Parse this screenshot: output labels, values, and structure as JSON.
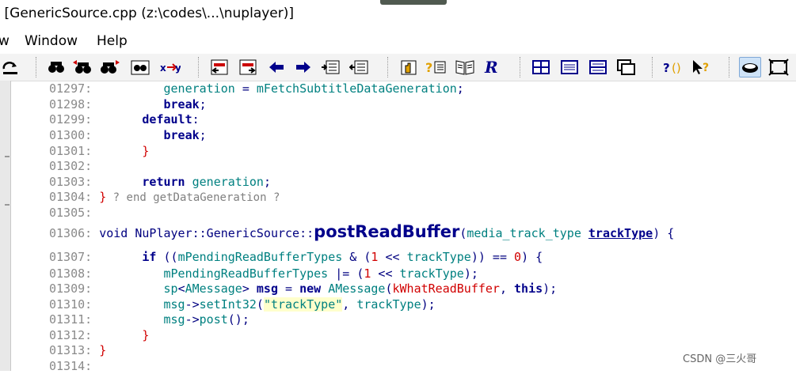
{
  "window": {
    "title": "- [GenericSource.cpp (z:\\codes\\...\\nuplayer)]"
  },
  "menu": {
    "items": [
      "w",
      "Window",
      "Help"
    ]
  },
  "toolbar": {
    "icons": [
      "redo-icon",
      "find-icon",
      "find-prev-icon",
      "find-next-icon",
      "find-files-icon",
      "replace-icon",
      "jump-back-icon",
      "jump-forward-icon",
      "back-arrow-icon",
      "forward-arrow-icon",
      "indent-icon",
      "outdent-icon",
      "symbol-info-icon",
      "relation-icon",
      "book-icon",
      "r-icon",
      "layout-window-icon",
      "layout-panel-icon",
      "layout-split-icon",
      "layout-stack-icon",
      "context-help-icon",
      "pointer-help-icon",
      "toggle-icon",
      "frame-icon"
    ]
  },
  "code": {
    "lines": [
      {
        "n": "01297:",
        "text": "            generation = mFetchSubtitleDataGeneration;"
      },
      {
        "n": "01298:",
        "text": "            break;"
      },
      {
        "n": "01299:",
        "text": "        default:"
      },
      {
        "n": "01300:",
        "text": "            break;"
      },
      {
        "n": "01301:",
        "text": "        }"
      },
      {
        "n": "01302:",
        "text": ""
      },
      {
        "n": "01303:",
        "text": "        return generation;"
      },
      {
        "n": "01304:",
        "text": "} ? end getDataGeneration ?"
      },
      {
        "n": "01305:",
        "text": ""
      },
      {
        "n": "01306:",
        "text": "void NuPlayer::GenericSource::postReadBuffer(media_track_type trackType) {"
      },
      {
        "n": "01307:",
        "text": "        if ((mPendingReadBufferTypes & (1 << trackType)) == 0) {"
      },
      {
        "n": "01308:",
        "text": "            mPendingReadBufferTypes |= (1 << trackType);"
      },
      {
        "n": "01309:",
        "text": "            sp<AMessage> msg = new AMessage(kWhatReadBuffer, this);"
      },
      {
        "n": "01310:",
        "text": "            msg->setInt32(\"trackType\", trackType);"
      },
      {
        "n": "01311:",
        "text": "            msg->post();"
      },
      {
        "n": "01312:",
        "text": "        }"
      },
      {
        "n": "01313:",
        "text": "}"
      },
      {
        "n": "01314:",
        "text": ""
      }
    ]
  },
  "watermark": "CSDN @三火哥"
}
